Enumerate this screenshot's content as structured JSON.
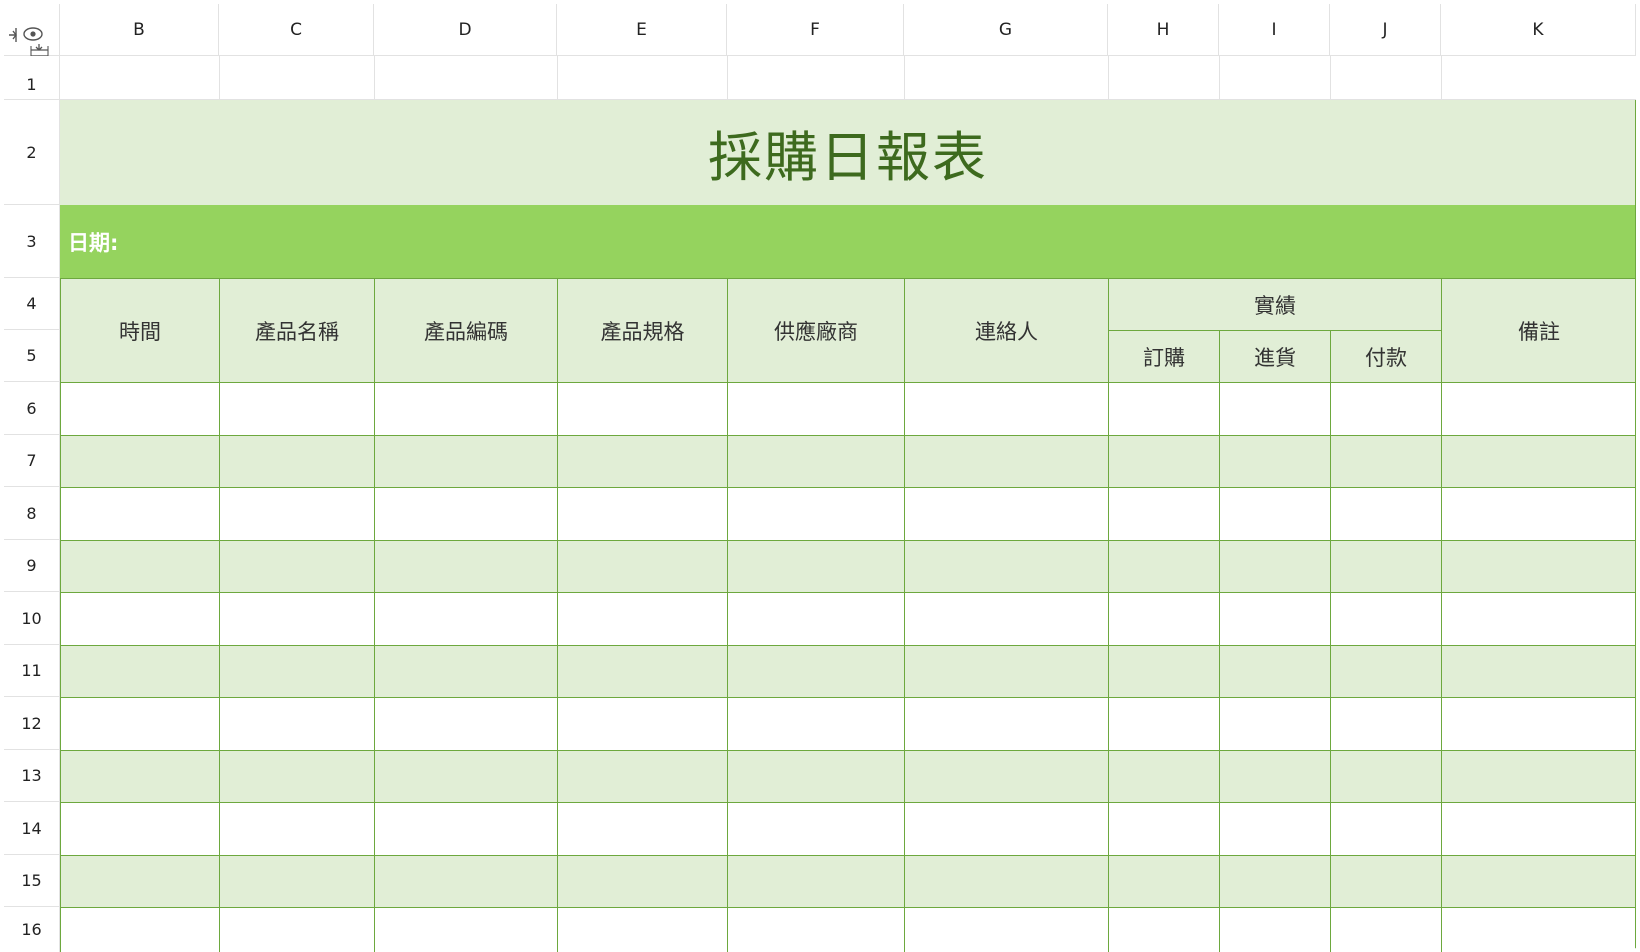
{
  "columns": [
    "B",
    "C",
    "D",
    "E",
    "F",
    "G",
    "H",
    "I",
    "J",
    "K"
  ],
  "rows": [
    "1",
    "2",
    "3",
    "4",
    "5",
    "6",
    "7",
    "8",
    "9",
    "10",
    "11",
    "12",
    "13",
    "14",
    "15",
    "16"
  ],
  "sheet": {
    "title": "採購日報表",
    "date_label": "日期:",
    "headers": {
      "time": "時間",
      "product_name": "產品名稱",
      "product_code": "產品編碼",
      "product_spec": "產品規格",
      "supplier": "供應廠商",
      "contact": "連絡人",
      "performance": "實績",
      "order": "訂購",
      "receive": "進貨",
      "payment": "付款",
      "remarks": "備註"
    }
  },
  "colors": {
    "title_bg": "#e1eed6",
    "title_text": "#3d6a1e",
    "date_bg": "#95d35e",
    "border": "#6da83e",
    "band": "#e1eed6"
  },
  "icons": {
    "corner": "freeze-panes-icon"
  }
}
